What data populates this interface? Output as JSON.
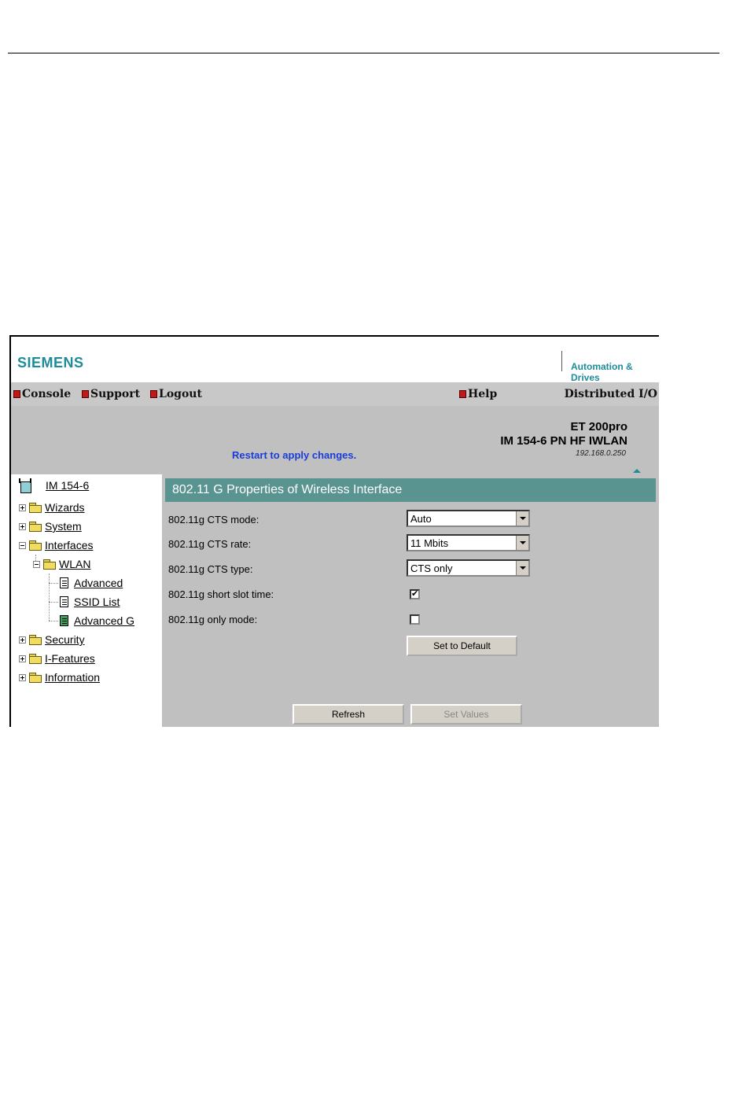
{
  "header": {
    "logo": "SIEMENS",
    "division": "Automation & Drives"
  },
  "menu": {
    "items": [
      {
        "label": "Console"
      },
      {
        "label": "Support"
      },
      {
        "label": "Logout"
      },
      {
        "label": "Help"
      }
    ],
    "product_line": "Distributed I/O"
  },
  "status": {
    "message": "Restart to apply changes.",
    "device_family": "ET 200pro",
    "device_model": "IM 154-6 PN HF IWLAN",
    "ip": "192.168.0.250"
  },
  "tree": {
    "root": "IM 154-6",
    "items": [
      "Wizards",
      "System",
      "Interfaces",
      "WLAN",
      "Advanced",
      "SSID List",
      "Advanced G",
      "Security",
      "I-Features",
      "Information"
    ]
  },
  "panel": {
    "title": "802.11 G Properties of Wireless Interface",
    "fields": {
      "cts_mode": {
        "label": "802.11g CTS mode:",
        "value": "Auto"
      },
      "cts_rate": {
        "label": "802.11g CTS rate:",
        "value": "11 Mbits"
      },
      "cts_type": {
        "label": "802.11g CTS type:",
        "value": "CTS only"
      },
      "short_slot": {
        "label": "802.11g short slot time:",
        "checked": true,
        "mark": "✔"
      },
      "only_mode": {
        "label": "802.11g only mode:",
        "checked": false
      }
    },
    "buttons": {
      "default": "Set to Default",
      "refresh": "Refresh",
      "set_values": "Set Values"
    }
  },
  "colors": {
    "brand_teal": "#1d8c99",
    "title_bar": "#5a9490",
    "status_text": "#1a3dd6",
    "panel_gray": "#c0c0c0"
  }
}
